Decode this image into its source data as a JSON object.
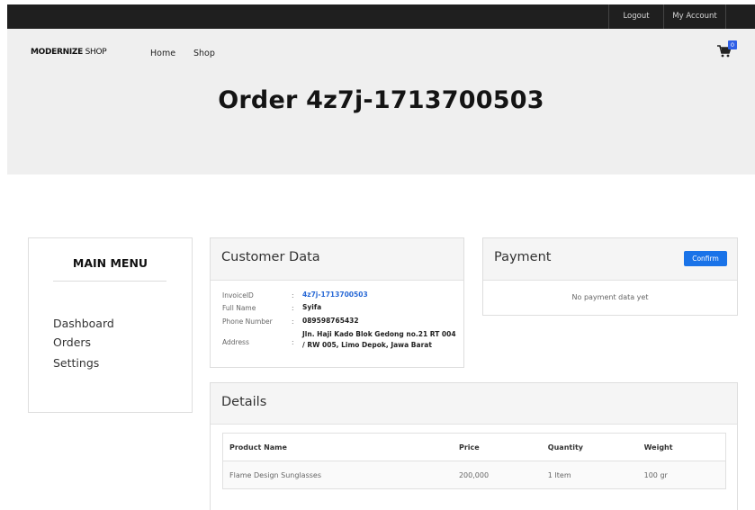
{
  "topbar": {
    "logout_label": "Logout",
    "account_label": "My Account"
  },
  "header": {
    "brand_bold": "MODERNIZE",
    "brand_light": " SHOP",
    "nav": [
      "Home",
      "Shop"
    ],
    "cart_count": "0",
    "page_title": "Order 4z7j-1713700503"
  },
  "sidebar": {
    "title": "MAIN MENU",
    "items": [
      "Dashboard",
      "Orders",
      "Settings"
    ]
  },
  "customer": {
    "title": "Customer Data",
    "fields": [
      {
        "label": "InvoiceID",
        "value": "4z7j-1713700503"
      },
      {
        "label": "Full Name",
        "value": "Syifa"
      },
      {
        "label": "Phone Number",
        "value": "089598765432"
      },
      {
        "label": "Address",
        "value": "Jln. Haji Kado Blok Gedong no.21 RT 004 / RW 005, Limo Depok, Jawa Barat"
      }
    ]
  },
  "payment": {
    "title": "Payment",
    "confirm_label": "Confirm",
    "empty_text": "No payment data yet"
  },
  "details": {
    "title": "Details",
    "columns": [
      "Product Name",
      "Price",
      "Quantity",
      "Weight"
    ],
    "rows": [
      [
        "Flame Design Sunglasses",
        "200,000",
        "1 Item",
        "100 gr"
      ]
    ]
  },
  "colors": {
    "accent": "#1a73e8",
    "link": "#2a6ad6",
    "topbar": "#1f1f1f",
    "header_bg": "#efefef"
  }
}
